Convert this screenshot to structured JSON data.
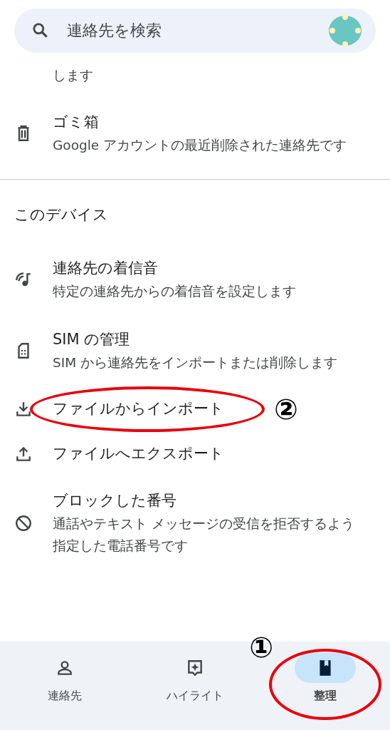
{
  "search": {
    "placeholder": "連絡先を検索"
  },
  "list_top": [
    {
      "kind": "continuation",
      "subtitle": "します"
    },
    {
      "kind": "item",
      "title": "ゴミ箱",
      "subtitle": "Google アカウントの最近削除された連絡先です"
    }
  ],
  "section": {
    "heading": "このデバイス",
    "items": [
      {
        "title": "連絡先の着信音",
        "subtitle": "特定の連絡先からの着信音を設定します"
      },
      {
        "title": "SIM の管理",
        "subtitle": "SIM から連絡先をインポートまたは削除します"
      },
      {
        "title": "ファイルからインポート",
        "annotation": "②"
      },
      {
        "title": "ファイルへエクスポート"
      },
      {
        "title": "ブロックした番号",
        "subtitle": "通話やテキスト メッセージの受信を拒否するよう指定した電話番号です"
      }
    ]
  },
  "bottom_nav": [
    {
      "label": "連絡先",
      "selected": false
    },
    {
      "label": "ハイライト",
      "selected": false
    },
    {
      "label": "整理",
      "selected": true,
      "annotation": "①"
    }
  ]
}
